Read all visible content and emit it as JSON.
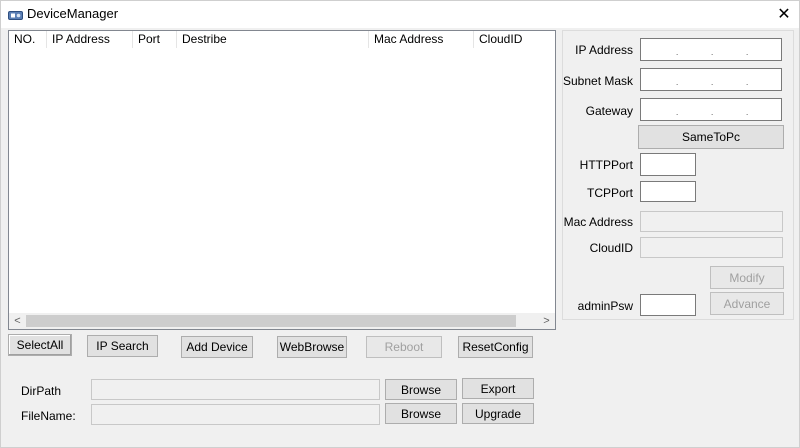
{
  "window": {
    "title": "DeviceManager",
    "close_glyph": "✕"
  },
  "device_list": {
    "columns": [
      "NO.",
      "IP Address",
      "Port",
      "Destribe",
      "Mac Address",
      "CloudID"
    ],
    "rows": [],
    "scroll_left": "<",
    "scroll_right": ">"
  },
  "action_buttons": {
    "select_all": "SelectAll",
    "ip_search": "IP Search",
    "add_device": "Add Device",
    "web_browse": "WebBrowse",
    "reboot": "Reboot",
    "reset_config": "ResetConfig"
  },
  "config_panel": {
    "ip_address_label": "IP Address",
    "subnet_mask_label": "Subnet Mask",
    "gateway_label": "Gateway",
    "same_to_pc": "SameToPc",
    "http_port_label": "HTTPPort",
    "tcp_port_label": "TCPPort",
    "mac_address_label": "Mac Address",
    "cloud_id_label": "CloudID",
    "modify": "Modify",
    "advance": "Advance",
    "admin_psw_label": "adminPsw",
    "ip_separator": "."
  },
  "upgrade": {
    "dir_path_label": "DirPath",
    "file_name_label": "FileName:",
    "browse_dir": "Browse",
    "browse_file": "Browse",
    "export": "Export",
    "upgrade": "Upgrade"
  }
}
